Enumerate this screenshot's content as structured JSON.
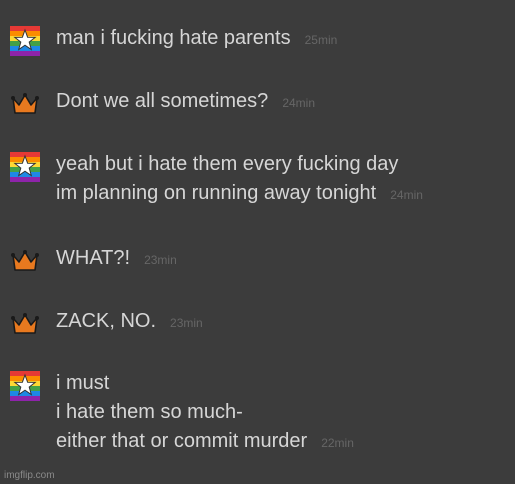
{
  "colors": {
    "background": "#3c3c3c",
    "message_text": "#d6d6d6",
    "timestamp": "#666666",
    "crown": "#e8791f"
  },
  "messages": [
    {
      "user": "rainbow-star-user",
      "lines": [
        "man i fucking hate parents"
      ],
      "time": "25min"
    },
    {
      "user": "crown-user",
      "lines": [
        "Dont we all sometimes?"
      ],
      "time": "24min"
    },
    {
      "user": "rainbow-star-user",
      "lines": [
        "yeah but i hate them every fucking day",
        "im planning on running away tonight"
      ],
      "time": "24min"
    },
    {
      "user": "crown-user",
      "lines": [
        "WHAT?!"
      ],
      "time": "23min"
    },
    {
      "user": "crown-user",
      "lines": [
        "ZACK, NO."
      ],
      "time": "23min"
    },
    {
      "user": "rainbow-star-user",
      "lines": [
        "i must",
        "i hate them so much-",
        "either that or commit murder"
      ],
      "time": "22min"
    }
  ],
  "icons": {
    "rainbow_star": "rainbow-star-icon",
    "crown": "crown-icon"
  },
  "watermark": "imgflip.com"
}
